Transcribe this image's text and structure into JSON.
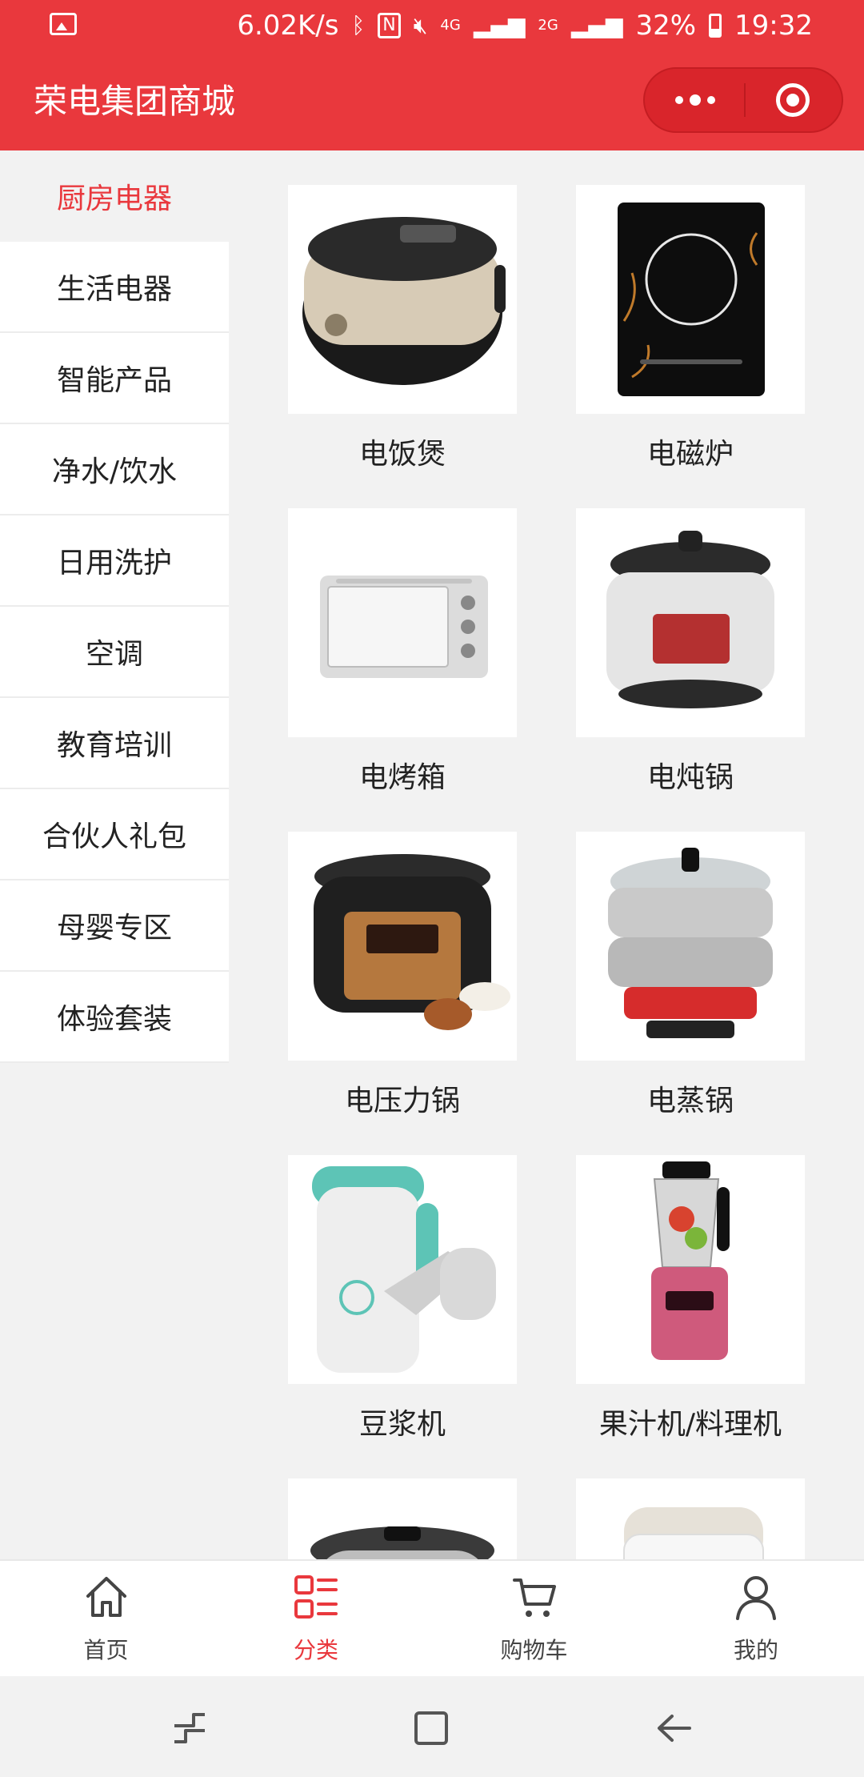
{
  "status_bar": {
    "speed": "6.02K/s",
    "network_4g": "4G",
    "network_2g": "2G",
    "battery": "32%",
    "time": "19:32"
  },
  "header": {
    "title": "荣电集团商城"
  },
  "sidebar": {
    "items": [
      {
        "label": "厨房电器"
      },
      {
        "label": "生活电器"
      },
      {
        "label": "智能产品"
      },
      {
        "label": "净水/饮水"
      },
      {
        "label": "日用洗护"
      },
      {
        "label": "空调"
      },
      {
        "label": "教育培训"
      },
      {
        "label": "合伙人礼包"
      },
      {
        "label": "母婴专区"
      },
      {
        "label": "体验套装"
      }
    ]
  },
  "products": [
    {
      "name": "电饭煲",
      "icon": "rice-cooker-image"
    },
    {
      "name": "电磁炉",
      "icon": "induction-cooker-image"
    },
    {
      "name": "电烤箱",
      "icon": "oven-image"
    },
    {
      "name": "电炖锅",
      "icon": "stew-pot-image"
    },
    {
      "name": "电压力锅",
      "icon": "pressure-cooker-image"
    },
    {
      "name": "电蒸锅",
      "icon": "steamer-image"
    },
    {
      "name": "豆浆机",
      "icon": "soymilk-maker-image"
    },
    {
      "name": "果汁机/料理机",
      "icon": "blender-image"
    }
  ],
  "tabbar": {
    "items": [
      {
        "label": "首页",
        "icon": "home-icon"
      },
      {
        "label": "分类",
        "icon": "category-icon"
      },
      {
        "label": "购物车",
        "icon": "cart-icon"
      },
      {
        "label": "我的",
        "icon": "user-icon"
      }
    ]
  },
  "colors": {
    "brand": "#e9383d",
    "background": "#f2f2f2"
  }
}
